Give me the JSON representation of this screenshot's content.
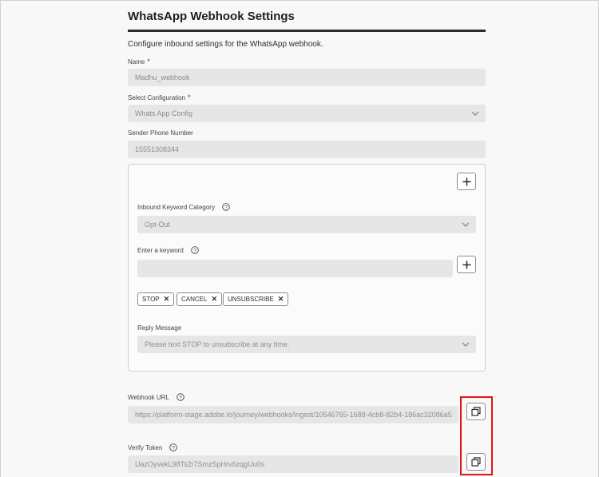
{
  "page": {
    "title": "WhatsApp Webhook Settings",
    "description": "Configure inbound settings for the WhatsApp webhook."
  },
  "fields": {
    "name": {
      "label": "Name",
      "required_mark": "*",
      "value": "Madhu_webhook"
    },
    "configuration": {
      "label": "Select Configuration",
      "required_mark": "*",
      "value": "Whats App Config"
    },
    "sender_phone": {
      "label": "Sender Phone Number",
      "value": "15551308344"
    }
  },
  "keyword_panel": {
    "category": {
      "label": "Inbound Keyword Category",
      "value": "Opt-Out"
    },
    "keyword": {
      "label": "Enter a keyword",
      "value": ""
    },
    "tags": [
      "STOP",
      "CANCEL",
      "UNSUBSCRIBE"
    ],
    "reply": {
      "label": "Reply Message",
      "placeholder": "Please text STOP to unsubscribe at any time."
    }
  },
  "webhook": {
    "url_label": "Webhook URL",
    "url_value": "https://platform-stage.adobe.io/journey/webhooks/ingest/10546765-1688-4cb8-82b4-186ac32086a5",
    "token_label": "Verify Token",
    "token_value": "UazOyvekL98Ts2r7SmzSpHrv6zqgUu0s"
  },
  "icons": {
    "add": "plus-icon",
    "help": "help-circle-icon",
    "dropdown": "chevron-down-icon",
    "copy": "copy-icon",
    "remove_tag": "close-icon"
  },
  "colors": {
    "accent_highlight": "#e0141b",
    "field_bg": "#e6e6e6",
    "text_muted": "#8e8e8e"
  }
}
